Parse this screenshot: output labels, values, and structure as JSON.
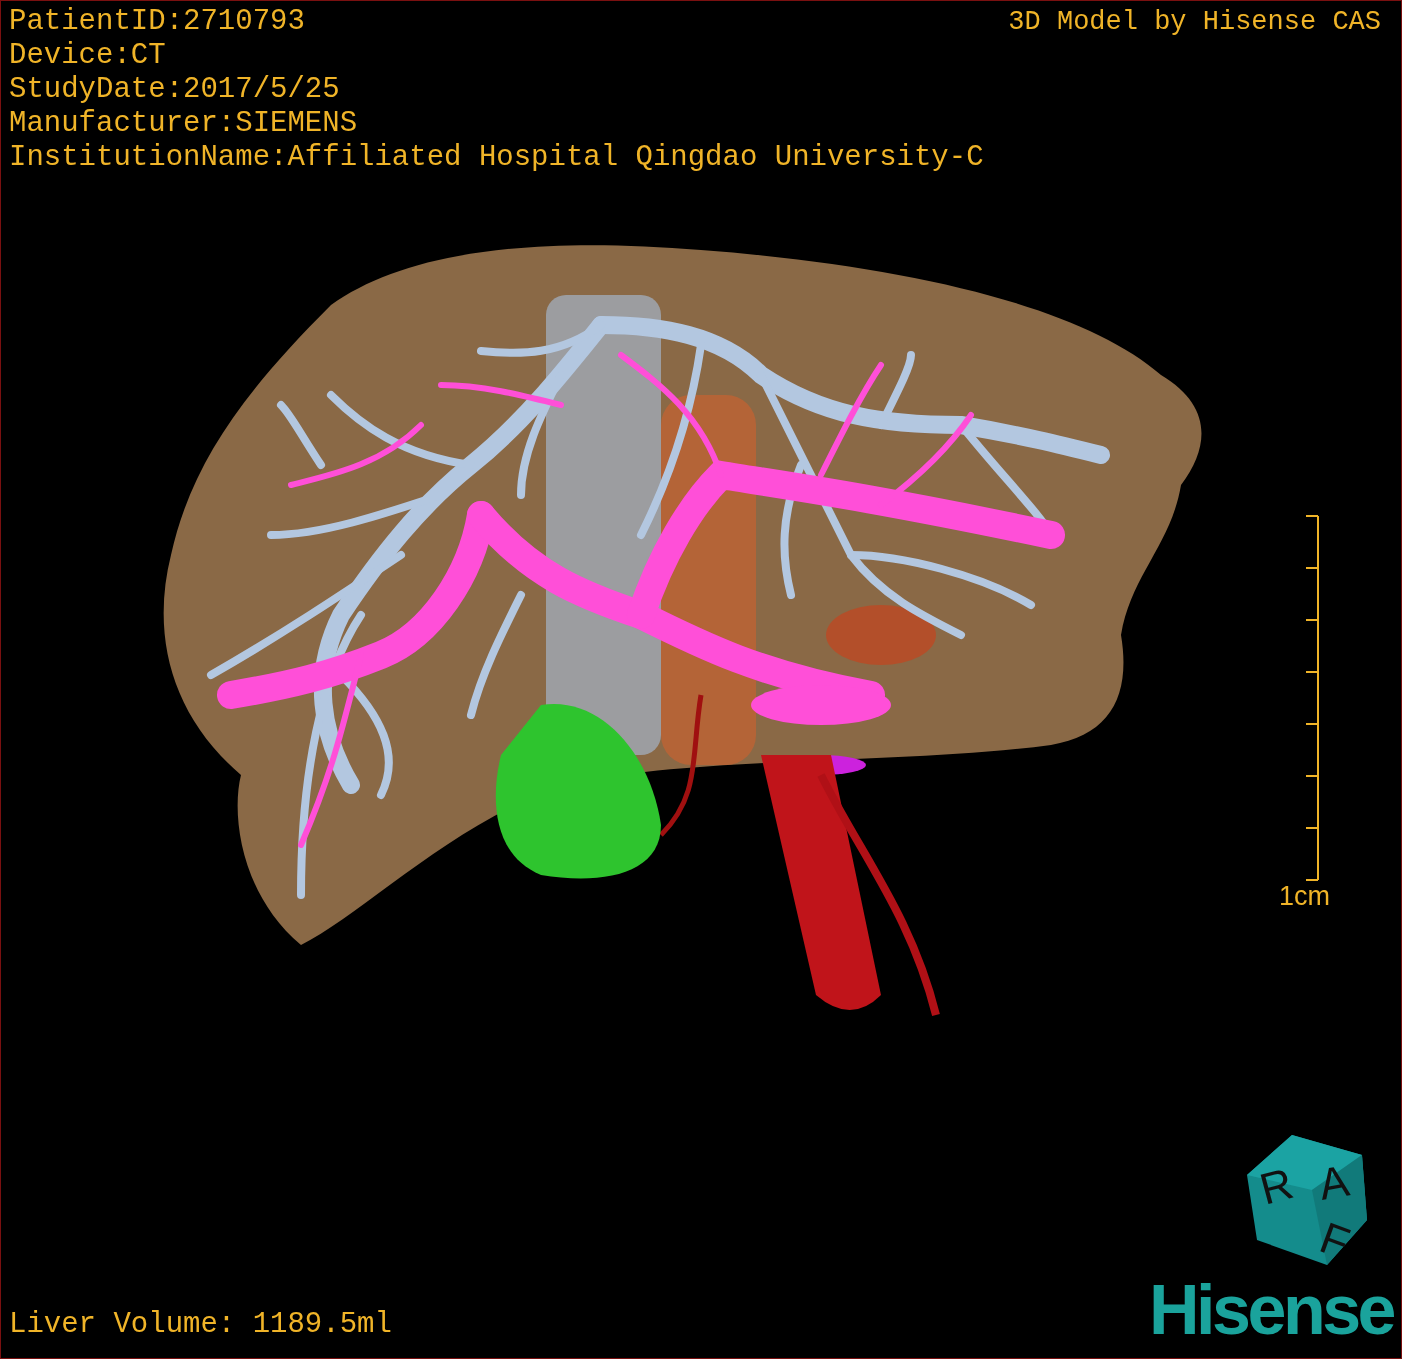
{
  "study_info": [
    {
      "text": "PatientID:2710793"
    },
    {
      "text": "Device:CT"
    },
    {
      "text": "StudyDate:2017/5/25"
    },
    {
      "text": "Manufacturer:SIEMENS"
    },
    {
      "text": "InstitutionName:Affiliated Hospital Qingdao University-C"
    }
  ],
  "credit": "3D Model by Hisense CAS",
  "scale_bar": {
    "label": "1cm"
  },
  "liver_volume": "Liver Volume: 1189.5ml",
  "orientation_cube": {
    "labels": [
      "R",
      "A",
      "F"
    ]
  },
  "logo": "Hisense"
}
